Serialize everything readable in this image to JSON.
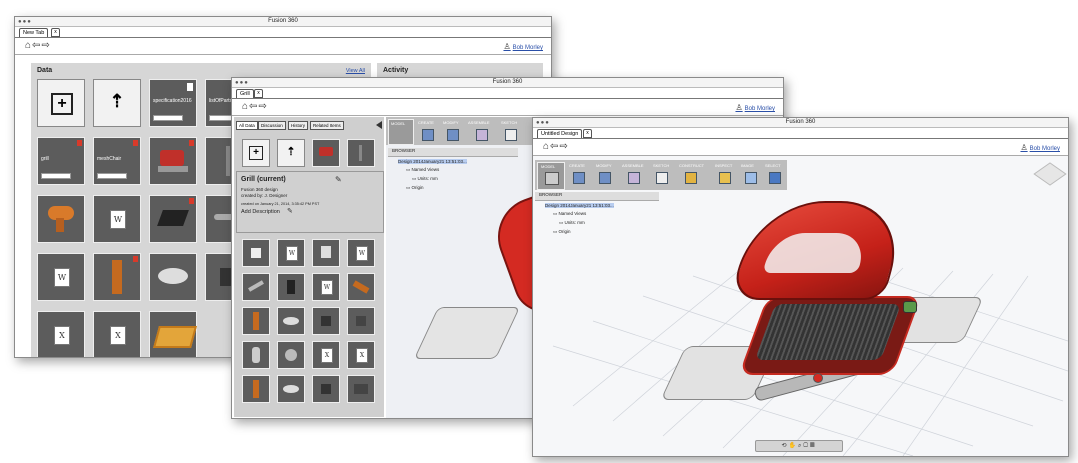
{
  "window1": {
    "app_title": "Fusion 360",
    "tab_label": "New Tab",
    "tab_close": "x",
    "user_name": "Bob Morley",
    "data_heading": "Data",
    "view_all": "View All",
    "activity_heading": "Activity",
    "tiles": [
      {
        "label": "specification2016"
      },
      {
        "label": "listOfParts"
      },
      {
        "label": "grill"
      },
      {
        "label": "meshChair"
      }
    ]
  },
  "window2": {
    "app_title": "Fusion 360",
    "tab_label": "Grill",
    "tab_close": "x",
    "user_name": "Bob Morley",
    "subtabs": [
      "All Data",
      "Discussion",
      "History",
      "Related Items"
    ],
    "details_title": "Grill (current)",
    "details_type": "Fusion 360 design",
    "details_created_by": "created by: J. Designer",
    "details_created_on": "created on January 21, 2014, 3:35:42 PM PST",
    "add_description": "Add Description",
    "toolbar": [
      "MODEL",
      "CREATE",
      "MODIFY",
      "ASSEMBLE",
      "SKETCH"
    ],
    "browser": {
      "title": "BROWSER",
      "root": "Design 2014January21 13:51:03...",
      "items": [
        "Named Views",
        "Units: mm",
        "Origin"
      ]
    }
  },
  "window3": {
    "app_title": "Fusion 360",
    "tab_label": "Untitled Design",
    "tab_close": "x",
    "user_name": "Bob Morley",
    "toolbar": [
      "MODEL",
      "CREATE",
      "MODIFY",
      "ASSEMBLE",
      "SKETCH",
      "CONSTRUCT",
      "INSPECT",
      "IMAGE",
      "SELECT"
    ],
    "browser": {
      "title": "BROWSER",
      "root": "Design 2014January21 13:51:03...",
      "items": [
        "Named Views",
        "Units: mm",
        "Origin"
      ]
    }
  },
  "icons": {
    "home": "⌂",
    "back": "⇦",
    "forward": "⇨",
    "user": "♙",
    "plus": "+",
    "upload": "⇡"
  },
  "colors": {
    "grill_red": "#d42a22",
    "selection_blue": "#b8cdf0",
    "tile_dark": "#5c5c5c"
  }
}
